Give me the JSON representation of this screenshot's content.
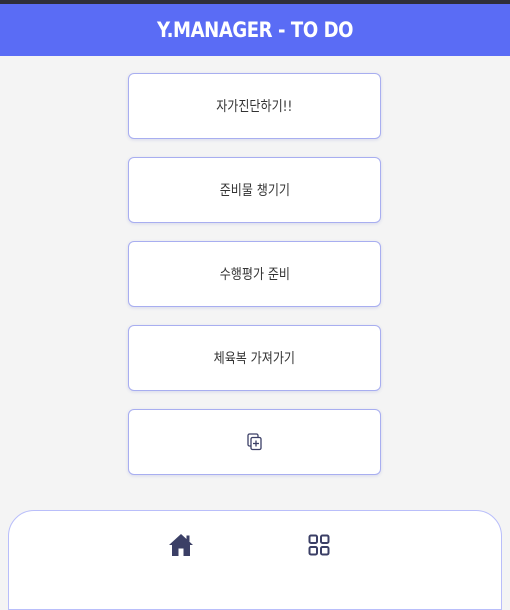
{
  "header": {
    "title": "Y.MANAGER - TO DO"
  },
  "todos": [
    {
      "label": "자가진단하기!!"
    },
    {
      "label": "준비물 챙기기"
    },
    {
      "label": "수행평가 준비"
    },
    {
      "label": "체육복 가져가기"
    }
  ],
  "add_item": {
    "icon": "add-note-icon"
  },
  "bottom_nav": {
    "items": [
      {
        "icon": "home-icon"
      },
      {
        "icon": "grid-icon"
      }
    ],
    "partial_text": ""
  },
  "colors": {
    "header_bg": "#5a6cf5",
    "card_border": "#a8aef0",
    "icon_color": "#3b3f66",
    "page_bg": "#f4f4f4"
  }
}
